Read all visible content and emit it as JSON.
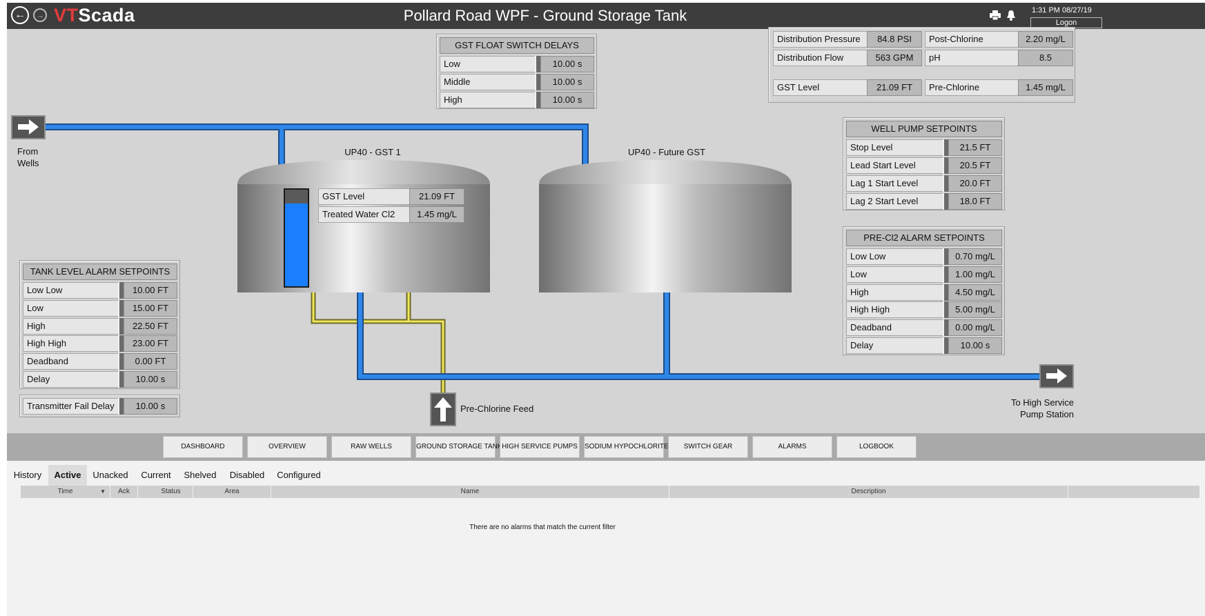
{
  "app": {
    "logo_red": "VT",
    "logo_white": "Scada",
    "title": "Pollard Road WPF - Ground Storage Tank",
    "clock": "1:31 PM  08/27/19",
    "logon_label": "Logon"
  },
  "icons": {
    "back": "back-arrow-icon",
    "forward": "forward-arrow-icon",
    "print": "printer-icon",
    "bell": "bell-icon"
  },
  "colors": {
    "water_pipe": "#2f7fe0",
    "chemical_pipe": "#e8e14a",
    "logo_accent": "#e53b3b",
    "tank_level_fill": "#1a7fff"
  },
  "summary": {
    "rows": [
      {
        "label": "Distribution Pressure",
        "value": "84.8 PSI",
        "label2": "Post-Chlorine",
        "value2": "2.20 mg/L"
      },
      {
        "label": "Distribution Flow",
        "value": "563 GPM",
        "label2": "pH",
        "value2": "8.5"
      },
      {
        "label": "GST Level",
        "value": "21.09 FT",
        "label2": "Pre-Chlorine",
        "value2": "1.45 mg/L"
      }
    ]
  },
  "float_delays": {
    "title": "GST FLOAT SWITCH DELAYS",
    "rows": [
      {
        "label": "Low",
        "value": "10.00 s"
      },
      {
        "label": "Middle",
        "value": "10.00 s"
      },
      {
        "label": "High",
        "value": "10.00 s"
      }
    ]
  },
  "well_pump": {
    "title": "WELL PUMP SETPOINTS",
    "rows": [
      {
        "label": "Stop Level",
        "value": "21.5 FT"
      },
      {
        "label": "Lead Start Level",
        "value": "20.5 FT"
      },
      {
        "label": "Lag 1 Start Level",
        "value": "20.0 FT"
      },
      {
        "label": "Lag 2 Start Level",
        "value": "18.0 FT"
      }
    ]
  },
  "precl2": {
    "title": "PRE-Cl2 ALARM SETPOINTS",
    "rows": [
      {
        "label": "Low Low",
        "value": "0.70 mg/L"
      },
      {
        "label": "Low",
        "value": "1.00 mg/L"
      },
      {
        "label": "High",
        "value": "4.50 mg/L"
      },
      {
        "label": "High High",
        "value": "5.00 mg/L"
      },
      {
        "label": "Deadband",
        "value": "0.00 mg/L"
      },
      {
        "label": "Delay",
        "value": "10.00 s"
      }
    ]
  },
  "tank_alarms": {
    "title": "TANK LEVEL ALARM SETPOINTS",
    "rows": [
      {
        "label": "Low Low",
        "value": "10.00 FT"
      },
      {
        "label": "Low",
        "value": "15.00 FT"
      },
      {
        "label": "High",
        "value": "22.50 FT"
      },
      {
        "label": "High High",
        "value": "23.00 FT"
      },
      {
        "label": "Deadband",
        "value": "0.00 FT"
      },
      {
        "label": "Delay",
        "value": "10.00 s"
      }
    ]
  },
  "transmitter": {
    "label": "Transmitter Fail Delay",
    "value": "10.00 s"
  },
  "tanks": {
    "gst1": {
      "title": "UP40 - GST 1",
      "level_fraction": 0.86,
      "rows": [
        {
          "label": "GST Level",
          "value": "21.09 FT"
        },
        {
          "label": "Treated Water Cl2",
          "value": "1.45 mg/L"
        }
      ]
    },
    "future": {
      "title": "UP40 - Future GST"
    }
  },
  "flows": {
    "from_wells_line1": "From",
    "from_wells_line2": "Wells",
    "to_hs_line1": "To High Service",
    "to_hs_line2": "Pump Station",
    "prechlorine_feed": "Pre-Chlorine Feed"
  },
  "nav": [
    "DASHBOARD",
    "OVERVIEW",
    "RAW WELLS",
    "GROUND STORAGE TANK",
    "HIGH SERVICE PUMPS",
    "SODIUM HYPOCHLORITE",
    "SWITCH GEAR",
    "ALARMS",
    "LOGBOOK"
  ],
  "alarms": {
    "tabs": [
      "History",
      "Active",
      "Unacked",
      "Current",
      "Shelved",
      "Disabled",
      "Configured"
    ],
    "columns": {
      "time": "Time",
      "ack": "Ack",
      "status": "Status",
      "area": "Area",
      "name": "Name",
      "description": "Description"
    },
    "empty_message": "There are no alarms that match the current filter"
  }
}
